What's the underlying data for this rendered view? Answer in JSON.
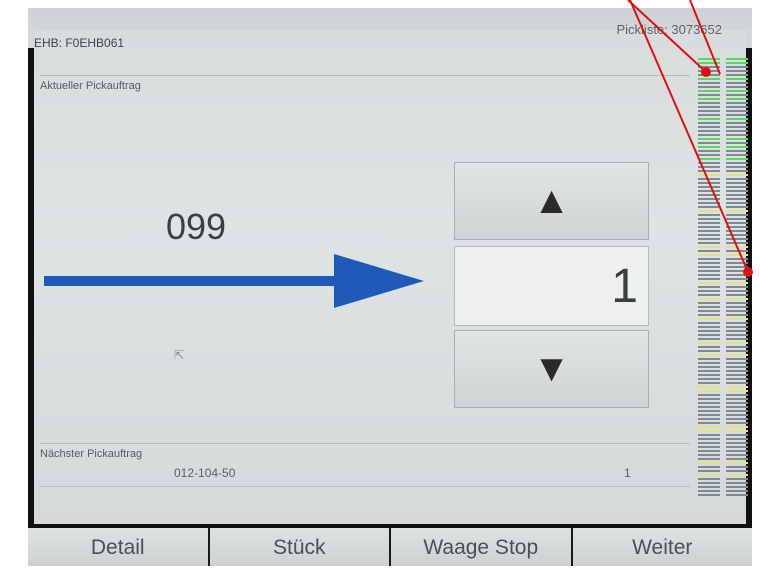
{
  "header": {
    "ehb": "EHB: F0EHB061",
    "pickliste": "Pickliste: 3073652"
  },
  "current": {
    "title": "Aktueller Pickauftrag",
    "order_number": "099",
    "quantity": "1"
  },
  "next": {
    "title": "Nächster Pickauftrag",
    "code": "012-104-50",
    "quantity": "1"
  },
  "icons": {
    "up": "triangle-up-icon",
    "down": "triangle-down-icon",
    "arrow": "arrow-right-icon",
    "cursor": "cursor-icon"
  },
  "colors": {
    "arrow": "#1e5bb8",
    "annotation": "#e01010",
    "bar_green": "#5ed65e",
    "bar_yellow": "#e5e08a",
    "bar_gray": "#7d8a94"
  },
  "tabs": [
    {
      "label": "Detail"
    },
    {
      "label": "Stück"
    },
    {
      "label": "Waage Stop"
    },
    {
      "label": "Weiter"
    }
  ]
}
